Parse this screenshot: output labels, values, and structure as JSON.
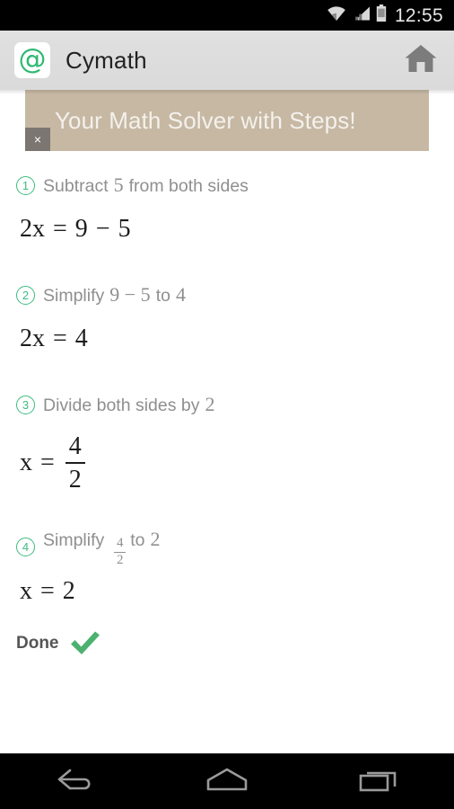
{
  "statusbar": {
    "time": "12:55",
    "icons": [
      "wifi-icon",
      "signal-icon",
      "battery-icon"
    ]
  },
  "appbar": {
    "icon": "cymath-at-icon",
    "title": "Cymath",
    "home_icon": "home-icon"
  },
  "banner": {
    "text": "Your Math Solver with Steps!",
    "close_label": "×",
    "background_color": "#c6b8a3",
    "text_color": "#f4f1ec"
  },
  "theme": {
    "accent_green": "#3cbc7d",
    "check_green": "#4cb16f",
    "step_text_gray": "#8f8f8f",
    "equation_black": "#1d1d1d"
  },
  "steps": [
    {
      "number": "1",
      "desc_parts": [
        {
          "type": "word",
          "text": "Subtract"
        },
        {
          "type": "math",
          "text": "5"
        },
        {
          "type": "word",
          "text": "from both sides"
        }
      ],
      "equation_tokens": [
        {
          "type": "text",
          "text": "2x"
        },
        {
          "type": "text",
          "text": "="
        },
        {
          "type": "text",
          "text": "9"
        },
        {
          "type": "text",
          "text": "−"
        },
        {
          "type": "text",
          "text": "5"
        }
      ],
      "equation_plain": "2x = 9 - 5"
    },
    {
      "number": "2",
      "desc_parts": [
        {
          "type": "word",
          "text": "Simplify"
        },
        {
          "type": "math",
          "text": "9 − 5"
        },
        {
          "type": "word",
          "text": "to"
        },
        {
          "type": "math",
          "text": "4"
        }
      ],
      "equation_tokens": [
        {
          "type": "text",
          "text": "2x"
        },
        {
          "type": "text",
          "text": "="
        },
        {
          "type": "text",
          "text": "4"
        }
      ],
      "equation_plain": "2x = 4"
    },
    {
      "number": "3",
      "desc_parts": [
        {
          "type": "word",
          "text": "Divide both sides by"
        },
        {
          "type": "math",
          "text": "2"
        }
      ],
      "equation_tokens": [
        {
          "type": "text",
          "text": "x"
        },
        {
          "type": "text",
          "text": "="
        },
        {
          "type": "fraction",
          "numerator": "4",
          "denominator": "2"
        }
      ],
      "equation_plain": "x = 4/2"
    },
    {
      "number": "4",
      "desc_parts": [
        {
          "type": "word",
          "text": "Simplify"
        },
        {
          "type": "fraction",
          "numerator": "4",
          "denominator": "2"
        },
        {
          "type": "word",
          "text": "to"
        },
        {
          "type": "math",
          "text": "2"
        }
      ],
      "equation_tokens": [
        {
          "type": "text",
          "text": "x"
        },
        {
          "type": "text",
          "text": "="
        },
        {
          "type": "text",
          "text": "2"
        }
      ],
      "equation_plain": "x = 2"
    }
  ],
  "done": {
    "label": "Done",
    "check_icon": "green-check-icon"
  },
  "navbar": {
    "back": "back-icon",
    "home": "home-icon",
    "recents": "recents-icon"
  }
}
